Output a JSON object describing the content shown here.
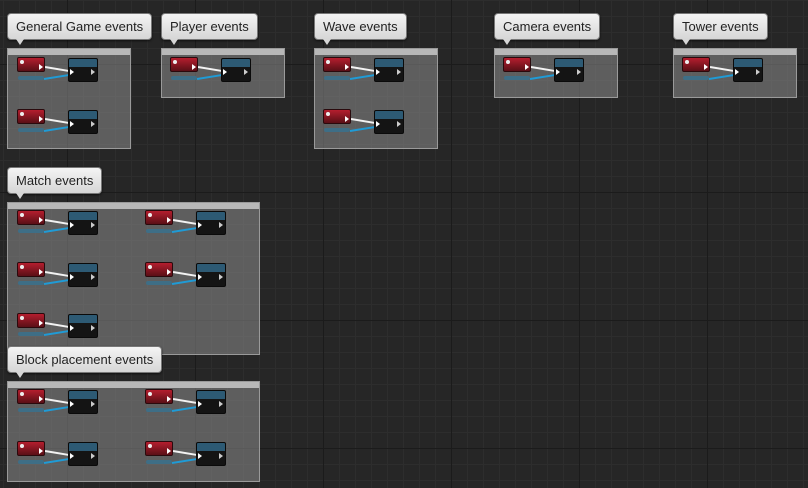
{
  "app": {
    "view": "Blueprint Event Graph"
  },
  "colors": {
    "canvas": "#262626",
    "comment_fill": "#8c8c8c",
    "bubble": "#e6e6e6",
    "event_node": "#b41e2e",
    "function_node_header": "#2d5a74",
    "exec_wire": "#f2f2f2",
    "data_wire": "#1f9bd6"
  },
  "icons": {
    "event_node": "red-event-node-icon",
    "exec_pin": "white-exec-pin-icon",
    "data_wire": "blue-data-wire-icon"
  },
  "comments": [
    {
      "title": "General Game events",
      "node_pairs": 2
    },
    {
      "title": "Player events",
      "node_pairs": 1
    },
    {
      "title": "Wave events",
      "node_pairs": 2
    },
    {
      "title": "Camera events",
      "node_pairs": 1
    },
    {
      "title": "Tower events",
      "node_pairs": 1
    },
    {
      "title": "Match events",
      "node_pairs": 5
    },
    {
      "title": "Block placement events",
      "node_pairs": 4
    }
  ]
}
